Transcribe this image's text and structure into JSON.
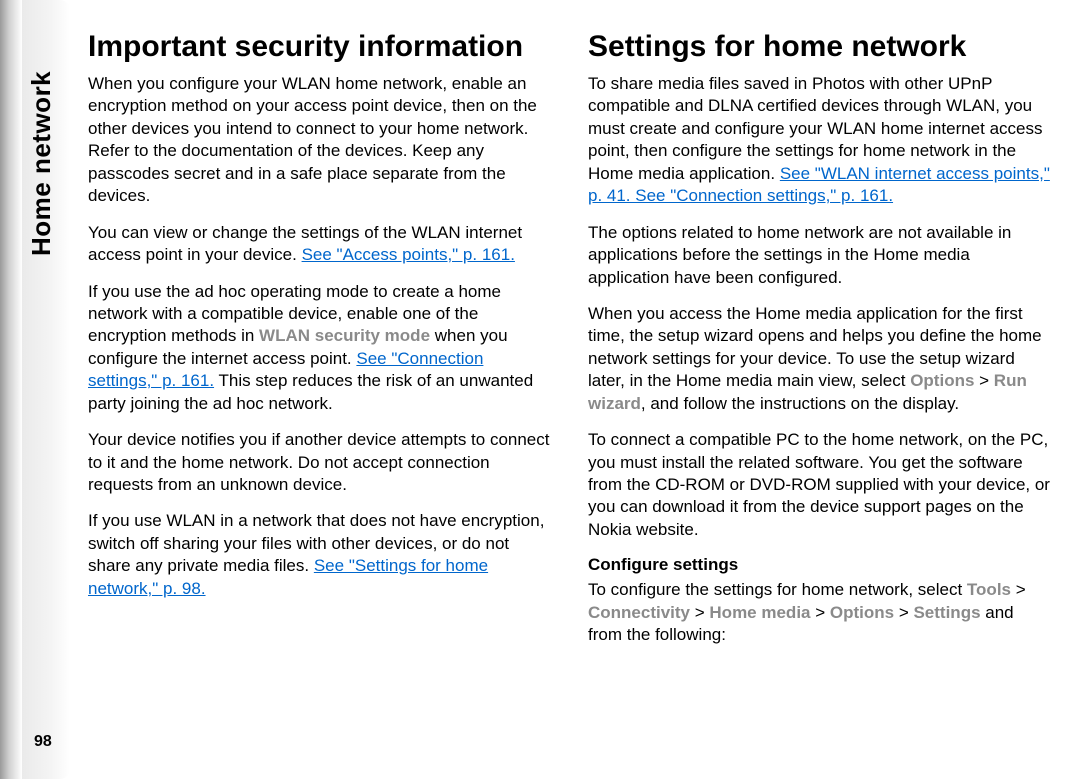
{
  "side_label": "Home network",
  "page_number": "98",
  "left": {
    "heading": "Important security information",
    "p1": "When you configure your WLAN home network, enable an encryption method on your access point device, then on the other devices you intend to connect to your home network. Refer to the documentation of the devices. Keep any passcodes secret and in a safe place separate from the devices.",
    "p2a": "You can view or change the settings of the WLAN internet access point in your device. ",
    "p2_link": "See \"Access points,\" p. 161.",
    "p3a": "If you use the ad hoc operating mode to create a home network with a compatible device, enable one of the encryption methods in ",
    "p3_term": "WLAN security mode",
    "p3b": " when you configure the internet access point. ",
    "p3_link": "See \"Connection settings,\" p. 161.",
    "p3c": " This step reduces the risk of an unwanted party joining the ad hoc network.",
    "p4": "Your device notifies you if another device attempts to connect to it and the home network. Do not accept connection requests from an unknown device.",
    "p5a": "If you use WLAN in a network that does not have encryption, switch off sharing your files with other devices, or do not share any private media files. ",
    "p5_link": "See \"Settings for home network,\" p. 98."
  },
  "right": {
    "heading": "Settings for home network",
    "p1a": "To share media files saved in Photos with other UPnP compatible and DLNA certified devices through WLAN, you must create and configure your WLAN home internet access point, then configure the settings for home network in the Home media application. ",
    "p1_link": "See \"WLAN internet access points,\" p. 41. See \"Connection settings,\" p. 161.",
    "p2": "The options related to home network are not available in applications before the settings in the Home media application have been configured.",
    "p3a": "When you access the Home media application for the first time, the setup wizard opens and helps you define the home network settings for your device. To use the setup wizard later, in the Home media main view, select ",
    "p3_t1": "Options",
    "gt": " > ",
    "p3_t2": "Run wizard",
    "p3b": ", and follow the instructions on the display.",
    "p4": "To connect a compatible PC to the home network, on the PC, you must install the related software. You get the software from the CD-ROM or DVD-ROM supplied with your device, or you can download it from the device support pages on the Nokia website.",
    "subhead": "Configure settings",
    "p5a": "To configure the settings for home network, select ",
    "p5_t1": "Tools",
    "p5_t2": "Connectivity",
    "p5_t3": "Home media",
    "p5_t4": "Options",
    "p5_t5": "Settings",
    "p5b": " and from the following:"
  }
}
